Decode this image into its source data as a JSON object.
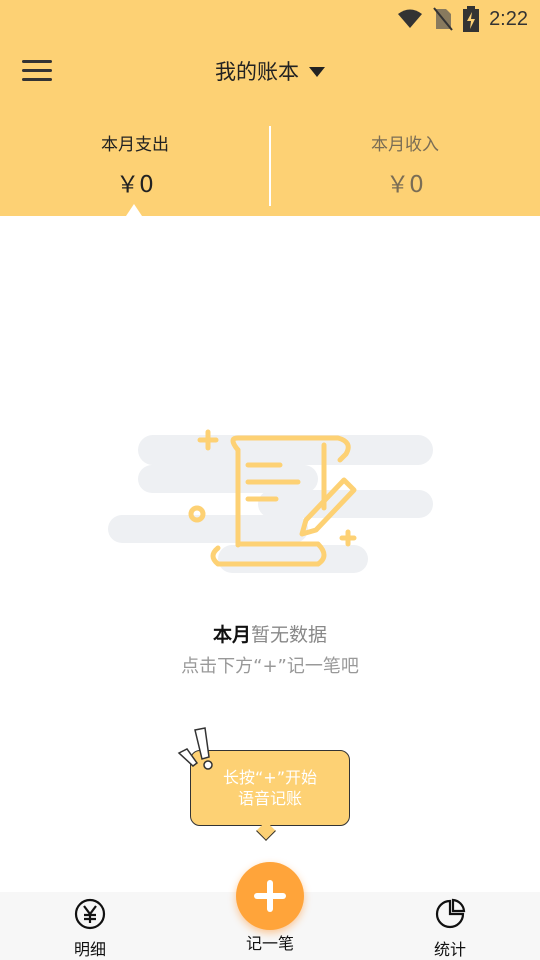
{
  "status_bar": {
    "time": "2:22",
    "icons": [
      "wifi-icon",
      "no-sim-icon",
      "battery-charging-icon"
    ]
  },
  "header": {
    "menu_icon": "hamburger-menu-icon",
    "book_title": "我的账本",
    "dropdown_icon": "caret-down-icon",
    "background_color": "#fdd174"
  },
  "summary": {
    "expense_label": "本月支出",
    "expense_value": "￥0",
    "income_label": "本月收入",
    "income_value": "￥0"
  },
  "empty_state": {
    "illustration": "scroll-with-pen-illustration",
    "title_strong": "本月",
    "title_light": "暂无数据",
    "hint": "点击下方“+”记一笔吧"
  },
  "voice_tip": {
    "line1": "长按“+”开始",
    "line2": "语音记账"
  },
  "tabbar": {
    "detail_label": "明细",
    "detail_icon": "yen-circle-icon",
    "add_label": "记一笔",
    "add_icon": "plus-icon",
    "stats_label": "统计",
    "stats_icon": "pie-chart-icon",
    "accent_color": "#ffa43a"
  }
}
